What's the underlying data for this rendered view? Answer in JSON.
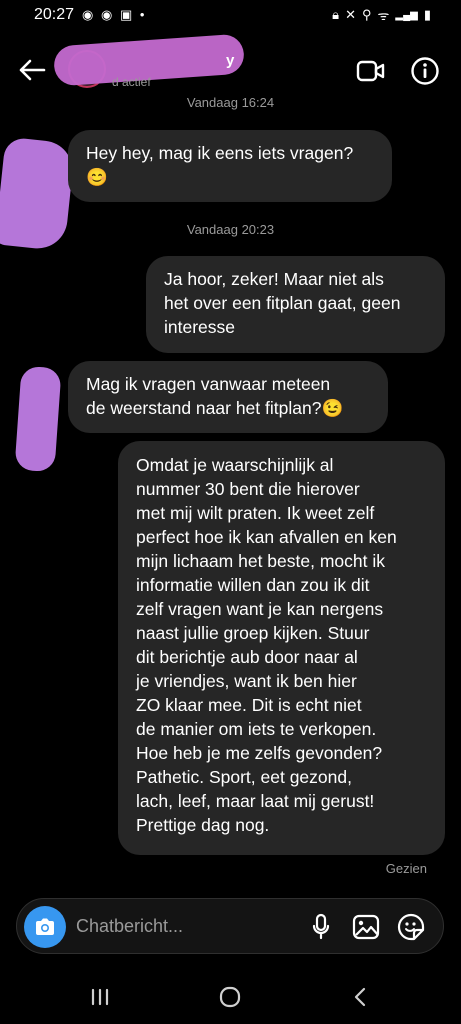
{
  "status_bar": {
    "time": "20:27",
    "left_icons": "◉ ✉ ▣ •",
    "right_icons": "⌂ ✕ ⚲ ᯤ Vo) LTE1 ▂▄▆ ▮"
  },
  "header": {
    "name_suffix": "y",
    "status": "d actief"
  },
  "messages": [
    {
      "type": "timestamp",
      "text": "Vandaag 16:24"
    },
    {
      "type": "incoming",
      "text": "Hey hey, mag ik eens iets vragen?\n😊"
    },
    {
      "type": "timestamp",
      "text": "Vandaag 20:23"
    },
    {
      "type": "outgoing",
      "text": "Ja hoor, zeker! Maar niet als\nhet over een fitplan gaat, geen\ninteresse"
    },
    {
      "type": "incoming",
      "text": "Mag ik vragen vanwaar meteen\nde weerstand naar het fitplan?😉"
    },
    {
      "type": "outgoing",
      "text": "Omdat je waarschijnlijk al\nnummer 30 bent die hierover\nmet mij wilt praten. Ik weet zelf\nperfect hoe ik kan afvallen en ken\nmijn lichaam het beste, mocht ik\ninformatie willen dan zou ik dit\nzelf vragen want je kan nergens\nnaast jullie groep kijken. Stuur\ndit berichtje aub door naar al\nje vriendjes, want ik ben hier\nZO klaar mee. Dit is echt niet\nde manier om iets te verkopen.\nHoe heb je me zelfs gevonden?\nPathetic. Sport, eet gezond,\nlach, leef, maar laat mij gerust!\nPrettige dag nog."
    }
  ],
  "seen": "Gezien",
  "composer": {
    "placeholder": "Chatbericht..."
  },
  "colors": {
    "background": "#000000",
    "bubble": "#262626",
    "accent": "#3797f0",
    "muted_text": "#9a9a9a",
    "redaction": "#b576d9"
  }
}
